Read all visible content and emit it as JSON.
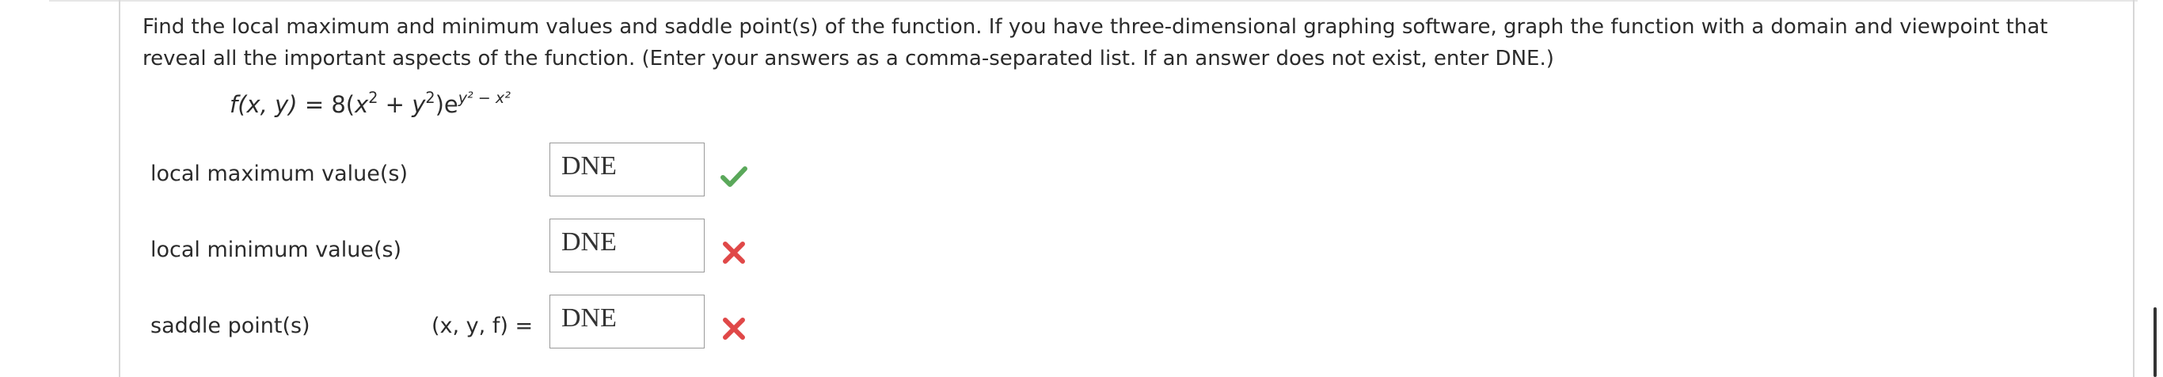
{
  "question": {
    "text": "Find the local maximum and minimum values and saddle point(s) of the function. If you have three-dimensional graphing software, graph the function with a domain and viewpoint that reveal all the important aspects of the function. (Enter your answers as a comma-separated list. If an answer does not exist, enter DNE.)"
  },
  "formula": {
    "lhs": "f(x, y)",
    "equals": "=",
    "coef": "8(",
    "x": "x",
    "exp2": "2",
    "plus": " + ",
    "y": "y",
    "close": ")e",
    "exponent": "y² − x²"
  },
  "answers": [
    {
      "label": "local maximum value(s)",
      "value": "DNE",
      "status": "correct",
      "status_icon": "check-icon"
    },
    {
      "label": "local minimum value(s)",
      "value": "DNE",
      "status": "incorrect",
      "status_icon": "x-icon"
    },
    {
      "label": "saddle point(s)",
      "prefix": "(x, y, f) =",
      "value": "DNE",
      "status": "incorrect",
      "status_icon": "x-icon"
    }
  ],
  "colors": {
    "correct": "#5aa85a",
    "incorrect": "#e04848",
    "border": "#9a9a9a"
  }
}
